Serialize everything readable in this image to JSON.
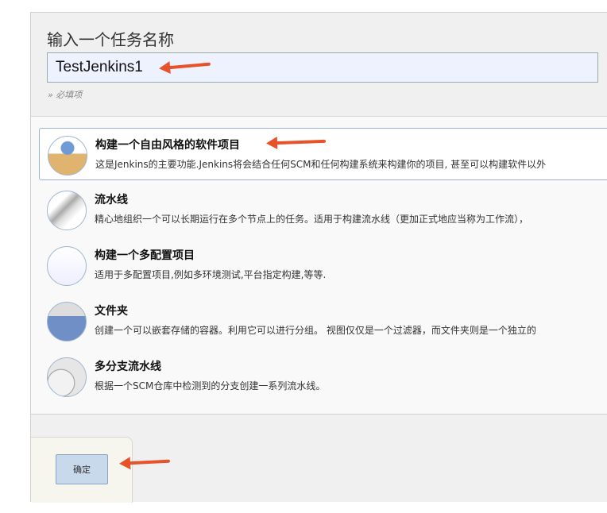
{
  "header": {
    "title": "输入一个任务名称",
    "name_value": "TestJenkins1",
    "required_hint": "» 必填项"
  },
  "items": [
    {
      "title": "构建一个自由风格的软件项目",
      "desc": "这是Jenkins的主要功能.Jenkins将会结合任何SCM和任何构建系统来构建你的项目, 甚至可以构建软件以外",
      "icon": "freestyle-box-icon"
    },
    {
      "title": "流水线",
      "desc": "精心地组织一个可以长期运行在多个节点上的任务。适用于构建流水线（更加正式地应当称为工作流），",
      "icon": "pipeline-icon"
    },
    {
      "title": "构建一个多配置项目",
      "desc": "适用于多配置项目,例如多环境测试,平台指定构建,等等.",
      "icon": "multi-config-icon"
    },
    {
      "title": "文件夹",
      "desc": "创建一个可以嵌套存储的容器。利用它可以进行分组。 视图仅仅是一个过滤器，而文件夹则是一个独立的",
      "icon": "folder-icon"
    },
    {
      "title": "多分支流水线",
      "desc": "根据一个SCM仓库中检测到的分支创建一系列流水线。",
      "icon": "multibranch-icon"
    }
  ],
  "footer": {
    "ok_label": "确定"
  },
  "colors": {
    "annotation_arrow": "#e8522a",
    "selected_border": "#9ab3cf"
  }
}
